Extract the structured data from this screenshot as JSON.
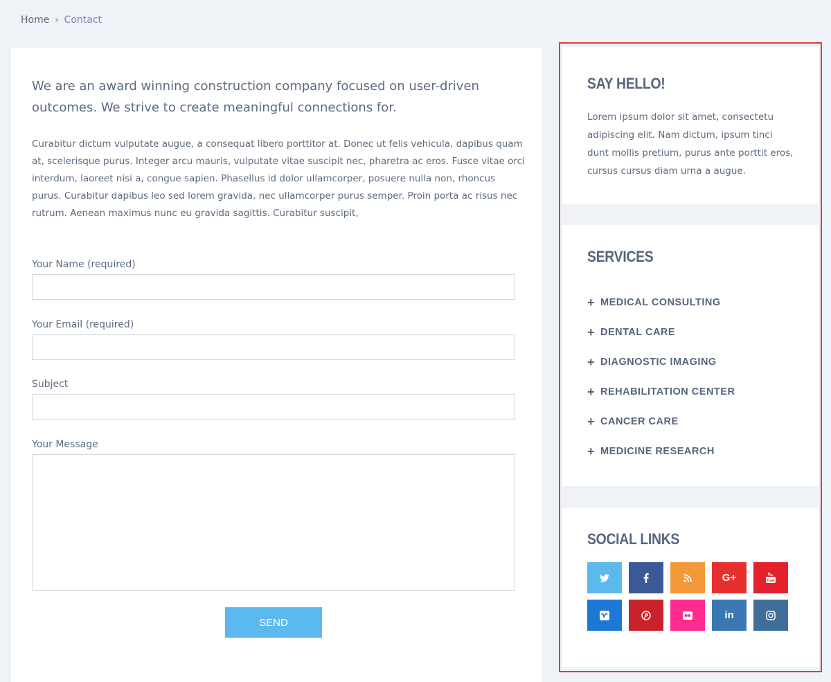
{
  "breadcrumb": {
    "home": "Home",
    "separator": "›",
    "current": "Contact"
  },
  "main": {
    "lead": "We are an award winning construction company focused on user-driven outcomes. We strive to create meaningful connections for.",
    "body": "Curabitur dictum vulputate augue, a consequat libero porttitor at. Donec ut felis vehicula, dapibus quam at, scelerisque purus. Integer arcu mauris, vulputate vitae suscipit nec, pharetra ac eros. Fusce vitae orci interdum, laoreet nisi a, congue sapien. Phasellus id dolor ullamcorper, posuere nulla non, rhoncus purus. Curabitur dapibus leo sed lorem gravida, nec ullamcorper purus semper. Proin porta ac risus nec rutrum. Aenean maximus nunc eu gravida sagittis. Curabitur suscipit,"
  },
  "form": {
    "name_label": "Your Name (required)",
    "name_value": "",
    "email_label": "Your Email (required)",
    "email_value": "",
    "subject_label": "Subject",
    "subject_value": "",
    "message_label": "Your Message",
    "message_value": "",
    "send_label": "SEND"
  },
  "sidebar": {
    "hello": {
      "title": "SAY HELLO!",
      "text": "Lorem ipsum dolor sit amet, consectetu adipiscing elit. Nam dictum, ipsum tinci dunt mollis pretium, purus ante porttit eros, cursus cursus diam urna a augue."
    },
    "services": {
      "title": "SERVICES",
      "items": [
        {
          "label": "MEDICAL CONSULTING"
        },
        {
          "label": "DENTAL CARE"
        },
        {
          "label": "DIAGNOSTIC IMAGING"
        },
        {
          "label": "REHABILITATION CENTER"
        },
        {
          "label": "CANCER CARE"
        },
        {
          "label": "MEDICINE RESEARCH"
        }
      ]
    },
    "social": {
      "title": "SOCIAL LINKS",
      "items": [
        {
          "icon": "twitter-icon",
          "color": "#5bb9ee"
        },
        {
          "icon": "facebook-icon",
          "color": "#3b5998"
        },
        {
          "icon": "rss-icon",
          "color": "#f4993a"
        },
        {
          "icon": "google-plus-icon",
          "color": "#e62f2f"
        },
        {
          "icon": "youtube-icon",
          "color": "#e3202c"
        },
        {
          "icon": "vimeo-icon",
          "color": "#1d77d6"
        },
        {
          "icon": "pinterest-icon",
          "color": "#c9222b"
        },
        {
          "icon": "flickr-icon",
          "color": "#ff2b8e"
        },
        {
          "icon": "linkedin-icon",
          "color": "#3a78b3"
        },
        {
          "icon": "instagram-icon",
          "color": "#3f6f99"
        }
      ]
    }
  }
}
